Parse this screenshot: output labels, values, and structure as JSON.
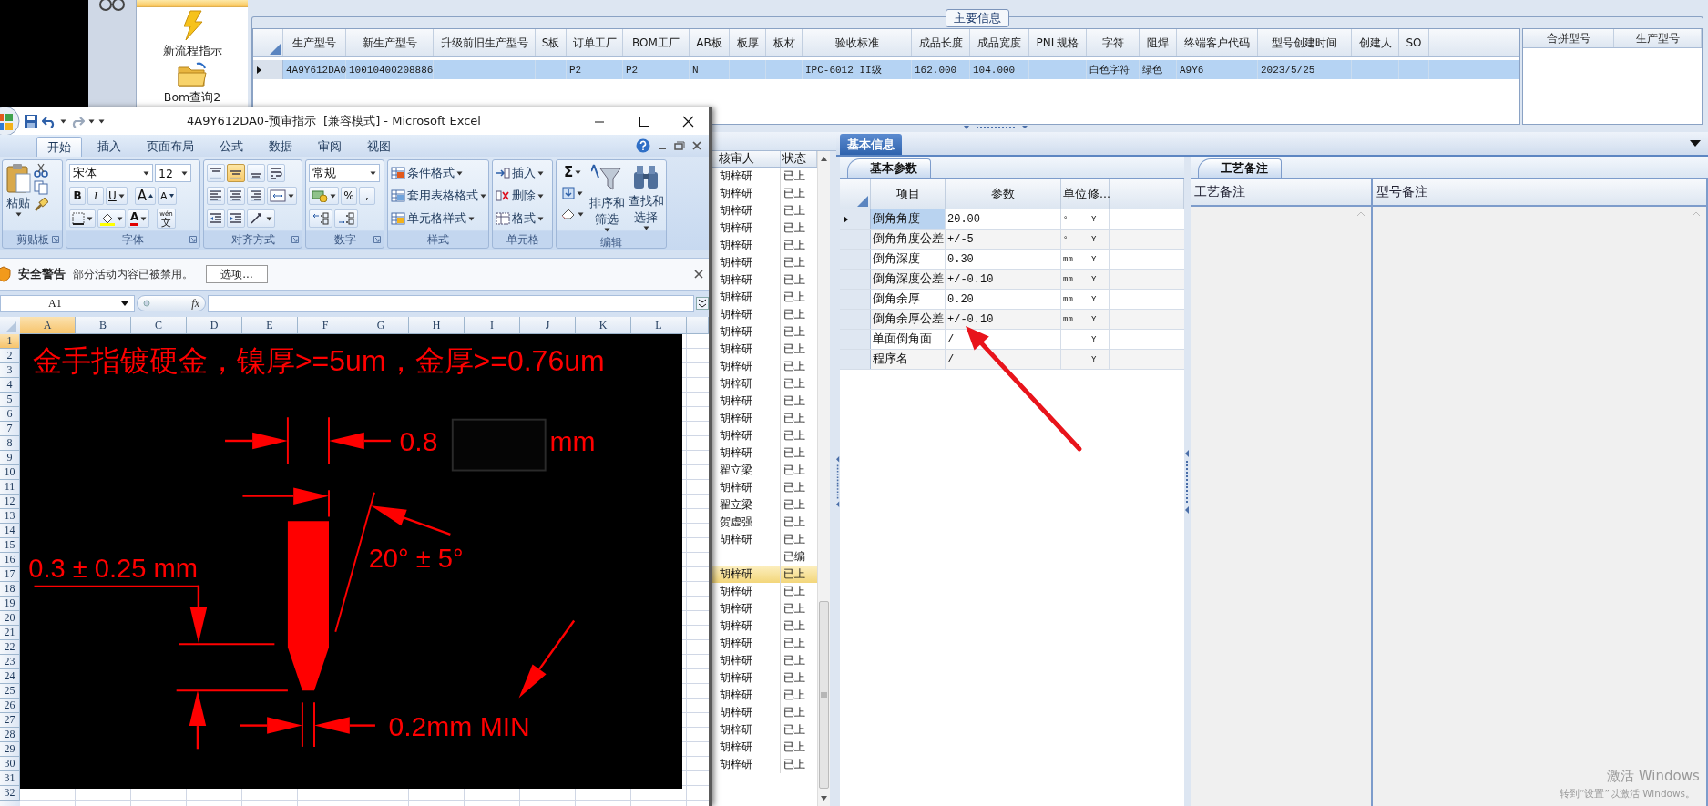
{
  "nav": {
    "items": [
      {
        "label": "新流程指示"
      },
      {
        "label": "Bom查询2"
      }
    ]
  },
  "main_info": {
    "title": "主要信息",
    "columns": [
      "生产型号",
      "新生产型号",
      "升级前旧生产型号",
      "S板",
      "订单工厂",
      "BOM工厂",
      "AB板",
      "板厚",
      "板材",
      "验收标准",
      "成品长度",
      "成品宽度",
      "PNL规格",
      "字符",
      "阻焊",
      "终端客户代码",
      "型号创建时间",
      "创建人",
      "SO"
    ],
    "rows": [
      {
        "selected": true,
        "cells": [
          "4A9Y612DA0",
          "10010400208886",
          null,
          null,
          "P2",
          "P2",
          "N",
          null,
          null,
          "IPC-6012 II级",
          "162.000",
          "104.000",
          null,
          "白色字符",
          "绿色",
          "A9Y6",
          "2023/5/25",
          null,
          null
        ]
      }
    ]
  },
  "merge_table": {
    "columns": [
      "合拼型号",
      "生产型号"
    ]
  },
  "review_list": {
    "columns": [
      "核审人",
      "状态"
    ],
    "rows": [
      {
        "reviewer": "胡梓研",
        "status": "已上",
        "selected": false
      },
      {
        "reviewer": "胡梓研",
        "status": "已上",
        "selected": false
      },
      {
        "reviewer": "胡梓研",
        "status": "已上",
        "selected": false
      },
      {
        "reviewer": "胡梓研",
        "status": "已上",
        "selected": false
      },
      {
        "reviewer": "胡梓研",
        "status": "已上",
        "selected": false
      },
      {
        "reviewer": "胡梓研",
        "status": "已上",
        "selected": false
      },
      {
        "reviewer": "胡梓研",
        "status": "已上",
        "selected": false
      },
      {
        "reviewer": "胡梓研",
        "status": "已上",
        "selected": false
      },
      {
        "reviewer": "胡梓研",
        "status": "已上",
        "selected": false
      },
      {
        "reviewer": "胡梓研",
        "status": "已上",
        "selected": false
      },
      {
        "reviewer": "胡梓研",
        "status": "已上",
        "selected": false
      },
      {
        "reviewer": "胡梓研",
        "status": "已上",
        "selected": false
      },
      {
        "reviewer": "胡梓研",
        "status": "已上",
        "selected": false
      },
      {
        "reviewer": "胡梓研",
        "status": "已上",
        "selected": false
      },
      {
        "reviewer": "胡梓研",
        "status": "已上",
        "selected": false
      },
      {
        "reviewer": "胡梓研",
        "status": "已上",
        "selected": false
      },
      {
        "reviewer": "胡梓研",
        "status": "已上",
        "selected": false
      },
      {
        "reviewer": "翟立梁",
        "status": "已上",
        "selected": false
      },
      {
        "reviewer": "胡梓研",
        "status": "已上",
        "selected": false
      },
      {
        "reviewer": "翟立梁",
        "status": "已上",
        "selected": false
      },
      {
        "reviewer": "贺虚强",
        "status": "已上",
        "selected": false
      },
      {
        "reviewer": "胡梓研",
        "status": "已上",
        "selected": false
      },
      {
        "status": "已编",
        "selected": false
      },
      {
        "reviewer": "胡梓研",
        "status": "已上",
        "selected": true
      },
      {
        "reviewer": "胡梓研",
        "status": "已上",
        "selected": false
      },
      {
        "reviewer": "胡梓研",
        "status": "已上",
        "selected": false
      },
      {
        "reviewer": "胡梓研",
        "status": "已上",
        "selected": false
      },
      {
        "reviewer": "胡梓研",
        "status": "已上",
        "selected": false
      },
      {
        "reviewer": "胡梓研",
        "status": "已上",
        "selected": false
      },
      {
        "reviewer": "胡梓研",
        "status": "已上",
        "selected": false
      },
      {
        "reviewer": "胡梓研",
        "status": "已上",
        "selected": false
      },
      {
        "reviewer": "胡梓研",
        "status": "已上",
        "selected": false
      },
      {
        "reviewer": "胡梓研",
        "status": "已上",
        "selected": false
      },
      {
        "reviewer": "胡梓研",
        "status": "已上",
        "selected": false
      },
      {
        "reviewer": "胡梓研",
        "status": "已上",
        "selected": false
      }
    ]
  },
  "info": {
    "tabs": [
      {
        "label": "基本信息",
        "selected": true
      }
    ]
  },
  "params": {
    "tabs": [
      {
        "label": "基本参数",
        "selected": true
      }
    ],
    "columns": [
      "项目",
      "参数",
      "单位",
      "修..."
    ],
    "rows": [
      {
        "item": "倒角角度",
        "value": "20.00",
        "unit": "°",
        "flag": "Y",
        "selected": true
      },
      {
        "item": "倒角角度公差",
        "value": "+/-5",
        "unit": "°",
        "flag": "Y",
        "selected": false
      },
      {
        "item": "倒角深度",
        "value": "0.30",
        "unit": "mm",
        "flag": "Y",
        "selected": false
      },
      {
        "item": "倒角深度公差",
        "value": "+/-0.10",
        "unit": "mm",
        "flag": "Y",
        "selected": false
      },
      {
        "item": "倒角余厚",
        "value": "0.20",
        "unit": "mm",
        "flag": "Y",
        "selected": false
      },
      {
        "item": "倒角余厚公差",
        "value": "+/-0.10",
        "unit": "mm",
        "flag": "Y",
        "selected": false
      },
      {
        "item": "单面倒角面",
        "value": "/",
        "flag": "Y",
        "selected": false
      },
      {
        "item": "程序名",
        "value": "/",
        "flag": "Y",
        "selected": false
      }
    ]
  },
  "notes": {
    "tabs": [
      {
        "label": "工艺备注",
        "selected": true
      }
    ],
    "columns": [
      "工艺备注",
      "型号备注"
    ]
  },
  "excel": {
    "title": "4A9Y612DA0-预审指示  [兼容模式] - Microsoft Excel",
    "tabs": [
      {
        "label": "开始",
        "selected": true
      },
      {
        "label": "插入",
        "selected": false
      },
      {
        "label": "页面布局",
        "selected": false
      },
      {
        "label": "公式",
        "selected": false
      },
      {
        "label": "数据",
        "selected": false
      },
      {
        "label": "审阅",
        "selected": false
      },
      {
        "label": "视图",
        "selected": false
      }
    ],
    "clipboard": {
      "paste": "粘贴",
      "label": "剪贴板"
    },
    "font": {
      "name": "宋体",
      "size": "12",
      "styles": [
        "B",
        "I",
        "U"
      ],
      "grow": "A",
      "shrink": "A",
      "color_button": "A",
      "phonetic": [
        "wén",
        "文"
      ],
      "label": "字体"
    },
    "alignment": {
      "label": "对齐方式",
      "vertical": [
        {
          "selected": false
        },
        {
          "selected": true
        },
        {
          "selected": false
        }
      ]
    },
    "number": {
      "format": "常规",
      "percent": "%",
      "comma": ",",
      "label": "数字"
    },
    "styles": {
      "items": [
        "条件格式",
        "套用表格格式",
        "单元格样式"
      ],
      "label": "样式"
    },
    "cells": {
      "items": [
        "插入",
        "删除",
        "格式"
      ],
      "label": "单元格"
    },
    "editing": {
      "sum": "Σ",
      "items": [
        "排序和筛选",
        "查找和选择"
      ],
      "label": "编辑"
    },
    "security": {
      "title": "安全警告",
      "message": "部分活动内容已被禁用。",
      "button": "选项..."
    },
    "name_box": "A1",
    "fx": "fx",
    "columns": [
      {
        "label": "A",
        "selected": true
      },
      {
        "label": "B",
        "selected": false
      },
      {
        "label": "C",
        "selected": false
      },
      {
        "label": "D",
        "selected": false
      },
      {
        "label": "E",
        "selected": false
      },
      {
        "label": "F",
        "selected": false
      },
      {
        "label": "G",
        "selected": false
      },
      {
        "label": "H",
        "selected": false
      },
      {
        "label": "I",
        "selected": false
      },
      {
        "label": "J",
        "selected": false
      },
      {
        "label": "K",
        "selected": false
      },
      {
        "label": "L",
        "selected": false
      }
    ],
    "rows": [
      {
        "label": "1",
        "selected": true
      },
      {
        "label": "2",
        "selected": false
      },
      {
        "label": "3",
        "selected": false
      },
      {
        "label": "4",
        "selected": false
      },
      {
        "label": "5",
        "selected": false
      },
      {
        "label": "6",
        "selected": false
      },
      {
        "label": "7",
        "selected": false
      },
      {
        "label": "8",
        "selected": false
      },
      {
        "label": "9",
        "selected": false
      },
      {
        "label": "10",
        "selected": false
      },
      {
        "label": "11",
        "selected": false
      },
      {
        "label": "12",
        "selected": false
      },
      {
        "label": "13",
        "selected": false
      },
      {
        "label": "14",
        "selected": false
      },
      {
        "label": "15",
        "selected": false
      },
      {
        "label": "16",
        "selected": false
      },
      {
        "label": "17",
        "selected": false
      },
      {
        "label": "18",
        "selected": false
      },
      {
        "label": "19",
        "selected": false
      },
      {
        "label": "20",
        "selected": false
      },
      {
        "label": "21",
        "selected": false
      },
      {
        "label": "22",
        "selected": false
      },
      {
        "label": "23",
        "selected": false
      },
      {
        "label": "24",
        "selected": false
      },
      {
        "label": "25",
        "selected": false
      },
      {
        "label": "26",
        "selected": false
      },
      {
        "label": "27",
        "selected": false
      },
      {
        "label": "28",
        "selected": false
      },
      {
        "label": "29",
        "selected": false
      },
      {
        "label": "30",
        "selected": false
      },
      {
        "label": "31",
        "selected": false
      },
      {
        "label": "32",
        "selected": false
      }
    ],
    "drawing": {
      "note": "金手指镀硬金，镍厚>=5um，金厚>=0.76um",
      "width_value": "0.8",
      "width_unit": "mm",
      "depth": "0.3 ± 0.25 mm",
      "angle": "20° ± 5°",
      "tip": "0.2mm MIN"
    }
  },
  "watermark": {
    "title": "激活 Windows",
    "hint": "转到“设置”以激活 Windows。"
  }
}
